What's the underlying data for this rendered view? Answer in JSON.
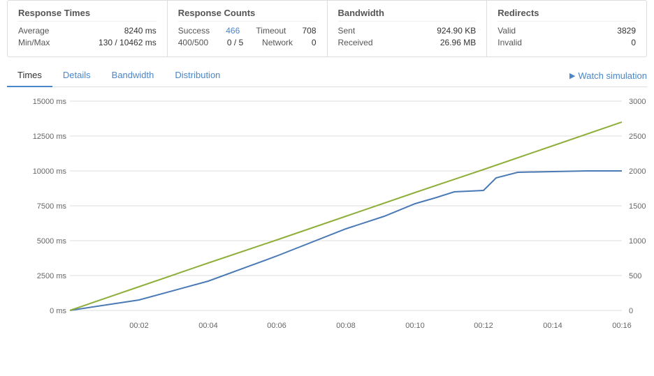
{
  "stats": {
    "response_times": {
      "title": "Response Times",
      "average_label": "Average",
      "average_value": "8240 ms",
      "minmax_label": "Min/Max",
      "minmax_value": "130 / 10462 ms"
    },
    "response_counts": {
      "title": "Response Counts",
      "success_label": "Success",
      "success_value": "466",
      "timeout_label": "Timeout",
      "timeout_value": "708",
      "code400_label": "400/500",
      "code400_value": "0 / 5",
      "network_label": "Network",
      "network_value": "0"
    },
    "bandwidth": {
      "title": "Bandwidth",
      "sent_label": "Sent",
      "sent_value": "924.90 KB",
      "received_label": "Received",
      "received_value": "26.96 MB"
    },
    "redirects": {
      "title": "Redirects",
      "valid_label": "Valid",
      "valid_value": "3829",
      "invalid_label": "Invalid",
      "invalid_value": "0"
    }
  },
  "tabs": {
    "times": "Times",
    "details": "Details",
    "bandwidth": "Bandwidth",
    "distribution": "Distribution",
    "watch_simulation": "Watch simulation"
  },
  "chart": {
    "y_left_labels": [
      "15000 ms",
      "12500 ms",
      "10000 ms",
      "7500 ms",
      "5000 ms",
      "2500 ms",
      "0 ms"
    ],
    "y_right_labels": [
      "3000",
      "2500",
      "2000",
      "1500",
      "1000",
      "500",
      "0"
    ],
    "x_labels": [
      "00:02",
      "00:04",
      "00:06",
      "00:08",
      "00:10",
      "00:12",
      "00:14",
      "00:16"
    ]
  }
}
